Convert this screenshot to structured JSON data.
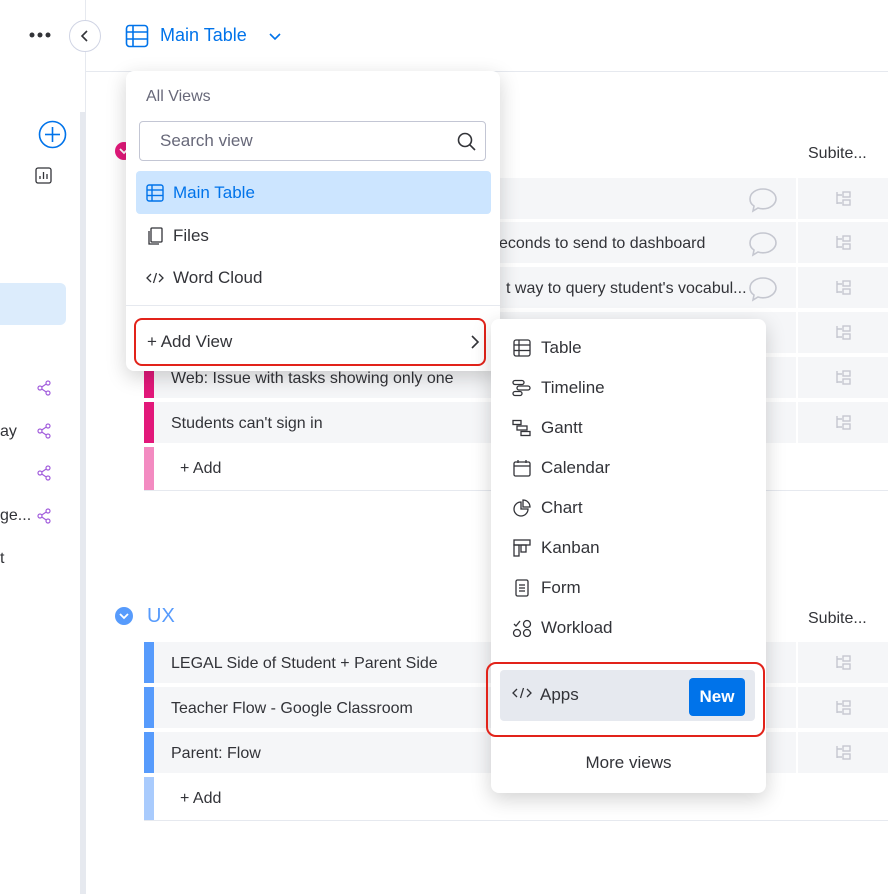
{
  "header": {
    "view_title": "Main Table",
    "more_icon": "more-dots-icon",
    "collapse_icon": "chevron-left-icon"
  },
  "sidebar": {
    "partial_items": [
      "ay",
      "ge...",
      "t"
    ]
  },
  "board": {
    "column_header": "Subite...",
    "groups": [
      {
        "title": "",
        "color": "#e2187a",
        "rows": [
          {
            "name": ""
          },
          {
            "name": "econds to send to dashboard"
          },
          {
            "name": "t way to query student's vocabul..."
          },
          {
            "name": ""
          },
          {
            "name": "Web: Issue with tasks showing only one"
          },
          {
            "name": "Students can't sign in"
          }
        ],
        "add_label": "+ Add"
      },
      {
        "title": "UX",
        "color": "#579bfc",
        "rows": [
          {
            "name": "LEGAL Side of Student + Parent Side"
          },
          {
            "name": "Teacher Flow - Google Classroom"
          },
          {
            "name": "Parent: Flow"
          }
        ],
        "add_label": "+ Add"
      }
    ]
  },
  "views_dropdown": {
    "heading": "All Views",
    "search_placeholder": "Search view",
    "items": [
      {
        "label": "Main Table",
        "icon": "table-icon",
        "selected": true
      },
      {
        "label": "Files",
        "icon": "files-icon",
        "selected": false
      },
      {
        "label": "Word Cloud",
        "icon": "code-icon",
        "selected": false
      }
    ],
    "add_view_label": "+ Add View"
  },
  "add_view_submenu": {
    "items": [
      {
        "label": "Table",
        "icon": "table-icon"
      },
      {
        "label": "Timeline",
        "icon": "timeline-icon"
      },
      {
        "label": "Gantt",
        "icon": "gantt-icon"
      },
      {
        "label": "Calendar",
        "icon": "calendar-icon"
      },
      {
        "label": "Chart",
        "icon": "chart-icon"
      },
      {
        "label": "Kanban",
        "icon": "kanban-icon"
      },
      {
        "label": "Form",
        "icon": "form-icon"
      },
      {
        "label": "Workload",
        "icon": "workload-icon"
      }
    ],
    "apps_label": "Apps",
    "apps_badge": "New",
    "more_views_label": "More views"
  },
  "colors": {
    "accent": "#0073ea",
    "highlight_border": "#e2231a",
    "selected_bg": "#cce5ff"
  }
}
